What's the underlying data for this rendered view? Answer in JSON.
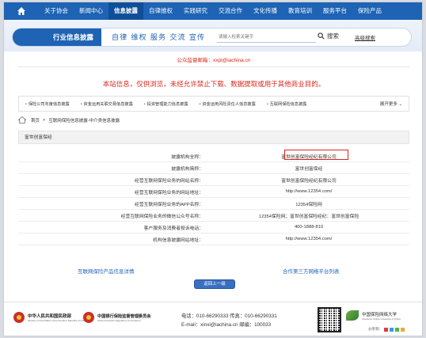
{
  "nav": {
    "items": [
      "关于协会",
      "新闻中心",
      "信息披露",
      "自律维权",
      "实践研究",
      "交流合作",
      "文化传播",
      "教育培训",
      "服务平台",
      "保险产品"
    ],
    "active_index": 2
  },
  "header": {
    "title": "行业信息披露",
    "slogan": "自律  维权  服务  交流  宣传",
    "search_placeholder": "请输入检索关键字",
    "search_label": "搜索",
    "advanced_label": "高级搜索"
  },
  "notice": "公众监督邮箱：xxpl@iachina.cn",
  "warning": "本站信息，仅供浏览，未经允许禁止下载、数据提取或用于其他商业目的。",
  "categories": {
    "items": [
      "保险公司年度信息披露",
      "资金运用关联交易信息披露",
      "投资管理能力信息披露",
      "资金运用风险责任人信息披露",
      "互联网保险信息披露"
    ],
    "more": "展开更多"
  },
  "breadcrumb": [
    "首页",
    "互联网保险信息披露-中介类信息披露"
  ],
  "panel": {
    "title": "富世创富保经",
    "rows": [
      {
        "label": "披露机构全称：",
        "value": "富世创富保险经纪有限公司"
      },
      {
        "label": "披露机构简称：",
        "value": "富世创富保经"
      },
      {
        "label": "经营互联网保险业务的网站名称：",
        "value": "富世创富保险经纪有限公司"
      },
      {
        "label": "经营互联网保险业务的网站地址：",
        "value": "http://www.12354.com/"
      },
      {
        "label": "经营互联网保险业务的APP名称：",
        "value": "12354保险网"
      },
      {
        "label": "经营互联网保险业务的微信公众号名称：",
        "value": "12354保险网；富世创富保险经纪：富世创富保险"
      },
      {
        "label": "客户服务及消费者投诉电话：",
        "value": "400-1888-810"
      },
      {
        "label": "机构信息披露网站地址：",
        "value": "http://www.12354.com/"
      }
    ]
  },
  "links": {
    "products": "互联网保险产品信息详情",
    "platforms": "合作第三方网络平台列表"
  },
  "back_button": "返回上一级",
  "footer": {
    "org1_name": "中华人民共和国民政部",
    "org1_en": "Ministry of Civil Affairs of the People's Republic of China",
    "org2_name": "中国银行保险监督管理委员会",
    "org2_en": "China Insurance Regulatory Commission",
    "contact_line1": "电话：010-66290333 传真：010-66290331",
    "contact_line2": "E-mail：xinxi@iachina.cn 邮编：100033",
    "org3_name": "中国保险网络大学",
    "org3_en": "Insurance Online University of China",
    "share_label": "分享到："
  },
  "colors": {
    "brand_blue": "#1e63b4",
    "alert_red": "#d9261c"
  }
}
